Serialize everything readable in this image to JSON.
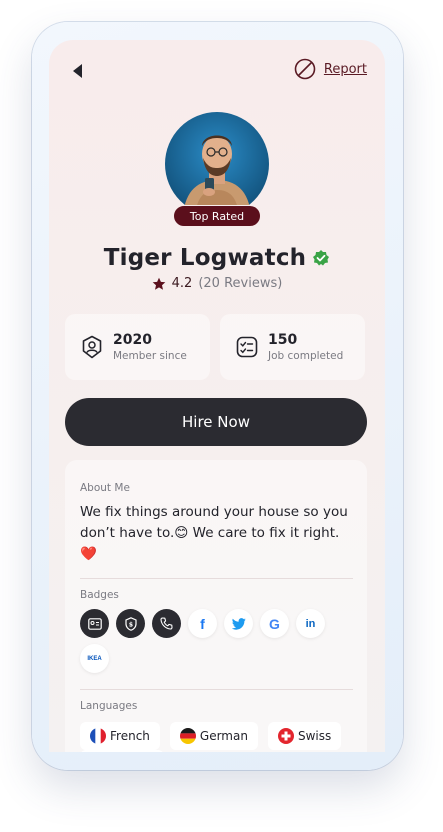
{
  "header": {
    "report_label": "Report"
  },
  "profile": {
    "badge_label": "Top Rated",
    "name": "Tiger Logwatch",
    "rating": "4.2",
    "reviews": "(20 Reviews)"
  },
  "stats": [
    {
      "value": "2020",
      "label": "Member since",
      "icon": "user-badge-icon"
    },
    {
      "value": "150",
      "label": "Job completed",
      "icon": "checklist-icon"
    }
  ],
  "hire_label": "Hire Now",
  "about": {
    "label": "About Me",
    "text": "We fix things around your house so you don’t have to.😊 We care to fix it right.❤️"
  },
  "badges": {
    "label": "Badges",
    "items": [
      {
        "icon": "id-card-icon",
        "style": "dark"
      },
      {
        "icon": "shield-icon",
        "style": "dark"
      },
      {
        "icon": "phone-icon",
        "style": "dark"
      },
      {
        "icon": "facebook-icon",
        "text": "f",
        "color": "#1877f2"
      },
      {
        "icon": "twitter-icon",
        "color": "#1d9bf0"
      },
      {
        "icon": "google-icon",
        "text": "G",
        "color": "#4285f4"
      },
      {
        "icon": "linkedin-icon",
        "text": "in",
        "color": "#0a66c2"
      },
      {
        "icon": "ikea-icon",
        "text": "IKEA",
        "color": "#0051ba"
      }
    ]
  },
  "languages": {
    "label": "Languages",
    "items": [
      {
        "name": "French",
        "icon": "france-flag-icon"
      },
      {
        "name": "German",
        "icon": "germany-flag-icon"
      },
      {
        "name": "Swiss",
        "icon": "switzerland-flag-icon"
      }
    ]
  },
  "colors": {
    "accent": "#5b0f1c",
    "button": "#2b2b31",
    "verified": "#3aa346"
  }
}
